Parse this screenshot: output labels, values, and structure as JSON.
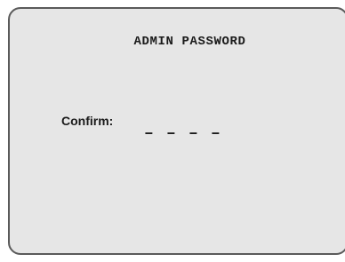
{
  "screen": {
    "title": "ADMIN PASSWORD",
    "confirm_label": "Confirm:",
    "pin_slots": [
      "–",
      "–",
      "–",
      "–"
    ]
  }
}
